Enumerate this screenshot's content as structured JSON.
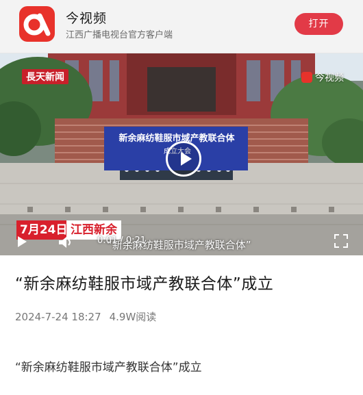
{
  "app_banner": {
    "name": "今视频",
    "subtitle": "江西广播电视台官方客户端",
    "open_button": "打开",
    "logo_icon": "app-logo-icon"
  },
  "video": {
    "watermark_left": "長天新闻",
    "watermark_right": "今视频",
    "stage_banner_title": "新余麻纺鞋服市域产教联合体",
    "stage_banner_sub": "成立大会",
    "date_badge": "7月24日",
    "source_badge": "江西新余",
    "caption": "“新余麻纺鞋服市域产教联合体”",
    "time": "0:01 / 0:21"
  },
  "article": {
    "headline": "“新余麻纺鞋服市域产教联合体”成立",
    "datetime": "2024-7-24 18:27",
    "views": "4.9W阅读",
    "body": "“新余麻纺鞋服市域产教联合体”成立"
  },
  "colors": {
    "brand_red": "#e8322b",
    "open_button": "#e23a47",
    "stage_blue": "#2a3fa6"
  }
}
